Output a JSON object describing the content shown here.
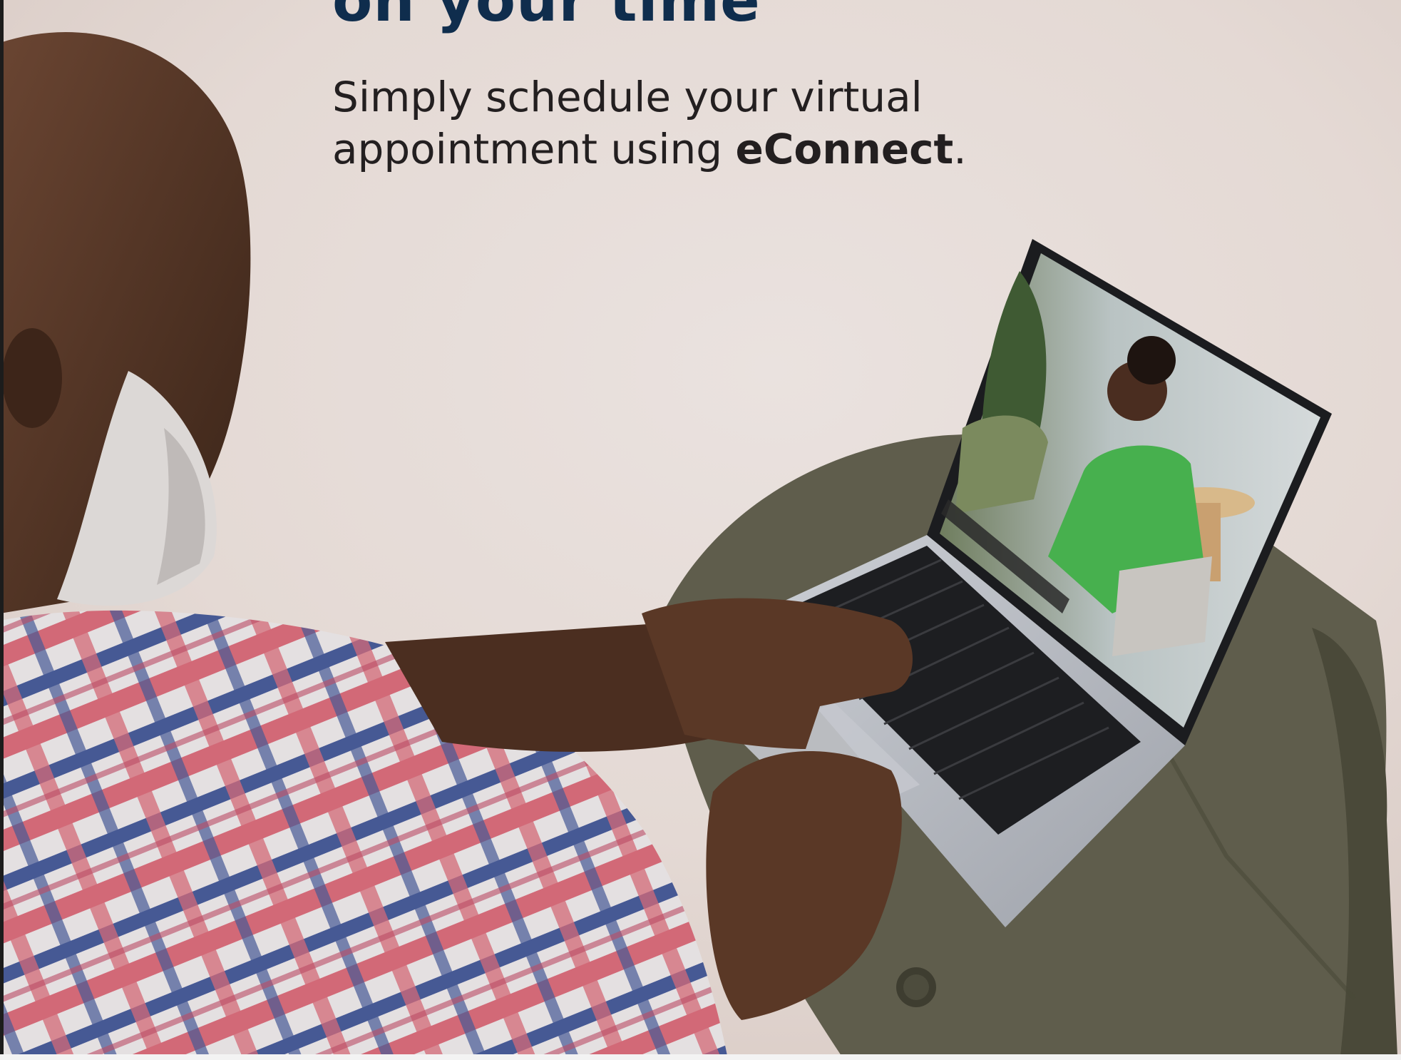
{
  "headline": "on your time",
  "subhead": {
    "line1": "Simply schedule your virtual",
    "line2_before": "appointment using ",
    "brand": "eConnect",
    "line2_after": "."
  },
  "colors": {
    "headline": "#0f2d4d",
    "body_text": "#231f20",
    "sand": "#e6dcd8",
    "shirt_red": "#e0707f",
    "shirt_blue": "#4b5f9e",
    "shorts": "#5f5d4c",
    "skin": "#5a3826",
    "laptop": "#b9bcc3",
    "screen_shirt": "#47b04e"
  }
}
